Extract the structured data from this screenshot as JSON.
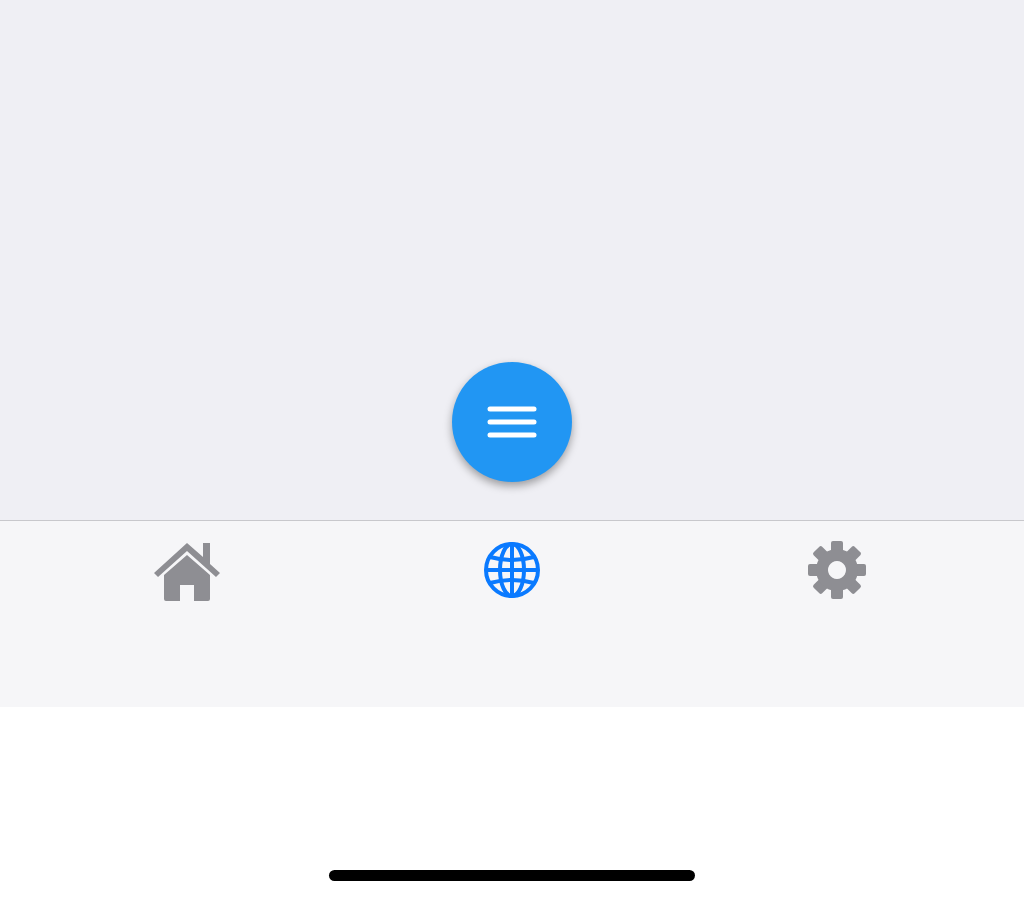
{
  "tab_bar": {
    "tabs": [
      {
        "kind": "home",
        "selected": false
      },
      {
        "kind": "globe",
        "selected": true
      },
      {
        "kind": "gear",
        "selected": false
      }
    ]
  }
}
